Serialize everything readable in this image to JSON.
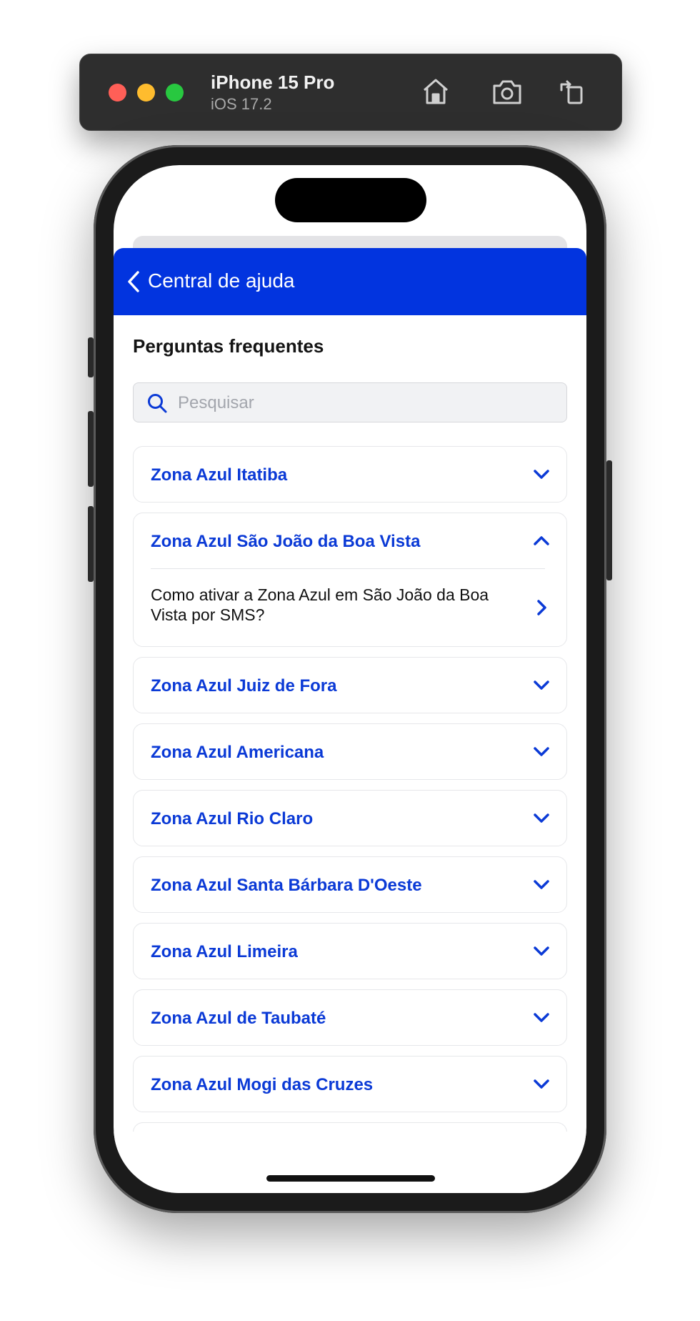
{
  "simulator": {
    "device_name": "iPhone 15 Pro",
    "os_version": "iOS 17.2",
    "icons": [
      "home-icon",
      "screenshot-icon",
      "rotate-icon"
    ]
  },
  "navbar": {
    "title": "Central de ajuda",
    "color": "#0234df"
  },
  "main": {
    "section_title": "Perguntas frequentes",
    "search": {
      "placeholder": "Pesquisar",
      "value": ""
    }
  },
  "faq": {
    "accent_color": "#0b3ad6",
    "items": [
      {
        "label": "Zona Azul Itatiba",
        "expanded": false
      },
      {
        "label": "Zona Azul São João da Boa Vista",
        "expanded": true,
        "questions": [
          "Como ativar a Zona Azul em São João da Boa Vista por SMS?"
        ]
      },
      {
        "label": "Zona Azul Juiz de Fora",
        "expanded": false
      },
      {
        "label": "Zona Azul Americana",
        "expanded": false
      },
      {
        "label": "Zona Azul Rio Claro",
        "expanded": false
      },
      {
        "label": "Zona Azul Santa Bárbara D'Oeste",
        "expanded": false
      },
      {
        "label": "Zona Azul Limeira",
        "expanded": false
      },
      {
        "label": "Zona Azul de Taubaté",
        "expanded": false
      },
      {
        "label": "Zona Azul Mogi das Cruzes",
        "expanded": false
      }
    ]
  }
}
